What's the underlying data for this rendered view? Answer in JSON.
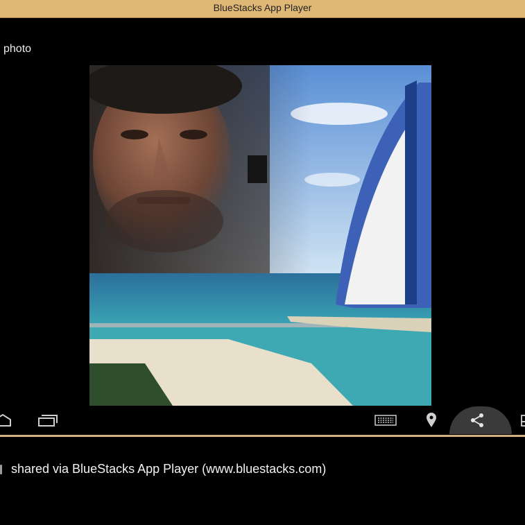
{
  "window": {
    "title": "BlueStacks App Player"
  },
  "app": {
    "photo_label": "photo"
  },
  "navbar": {
    "left": [
      {
        "icon": "home-icon"
      },
      {
        "icon": "recent-apps-icon"
      }
    ],
    "right": [
      {
        "icon": "keyboard-icon"
      },
      {
        "icon": "location-icon"
      },
      {
        "icon": "share-icon",
        "active": true
      },
      {
        "icon": "rotate-icon"
      }
    ]
  },
  "caption": {
    "text": "shared via BlueStacks App Player (www.bluestacks.com)"
  },
  "colors": {
    "titlebar": "#e0b876",
    "separator": "#d2b07a",
    "background": "#000000",
    "share_highlight": "#3a3a3a"
  }
}
